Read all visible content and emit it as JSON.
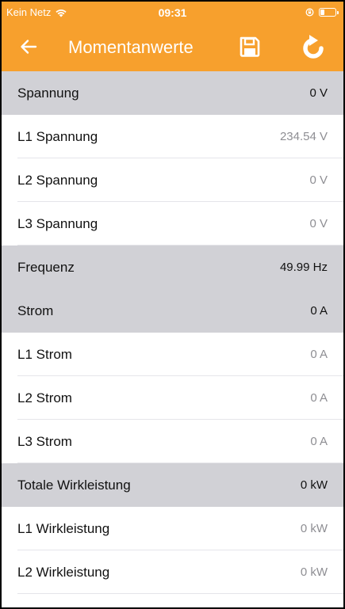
{
  "status_bar": {
    "carrier": "Kein Netz",
    "time": "09:31"
  },
  "nav": {
    "title": "Momentanwerte"
  },
  "rows": [
    {
      "type": "header",
      "label": "Spannung",
      "value": "0 V"
    },
    {
      "type": "item",
      "label": "L1 Spannung",
      "value": "234.54 V"
    },
    {
      "type": "item",
      "label": "L2 Spannung",
      "value": "0 V"
    },
    {
      "type": "item",
      "label": "L3 Spannung",
      "value": "0 V"
    },
    {
      "type": "header",
      "label": "Frequenz",
      "value": "49.99 Hz"
    },
    {
      "type": "header",
      "label": "Strom",
      "value": "0 A"
    },
    {
      "type": "item",
      "label": "L1 Strom",
      "value": "0 A"
    },
    {
      "type": "item",
      "label": "L2 Strom",
      "value": "0 A"
    },
    {
      "type": "item",
      "label": "L3 Strom",
      "value": "0 A"
    },
    {
      "type": "header",
      "label": "Totale Wirkleistung",
      "value": "0 kW"
    },
    {
      "type": "item",
      "label": "L1 Wirkleistung",
      "value": "0 kW"
    },
    {
      "type": "item",
      "label": "L2 Wirkleistung",
      "value": "0 kW"
    }
  ],
  "colors": {
    "accent": "#f7a02d",
    "section_header": "#d1d1d6",
    "value_gray": "#8e8e93"
  },
  "icons": {
    "back": "arrow-left-icon",
    "save": "floppy-disk-icon",
    "refresh": "refresh-icon",
    "wifi": "wifi-icon",
    "orientation_lock": "orientation-lock-icon",
    "battery": "battery-icon"
  }
}
